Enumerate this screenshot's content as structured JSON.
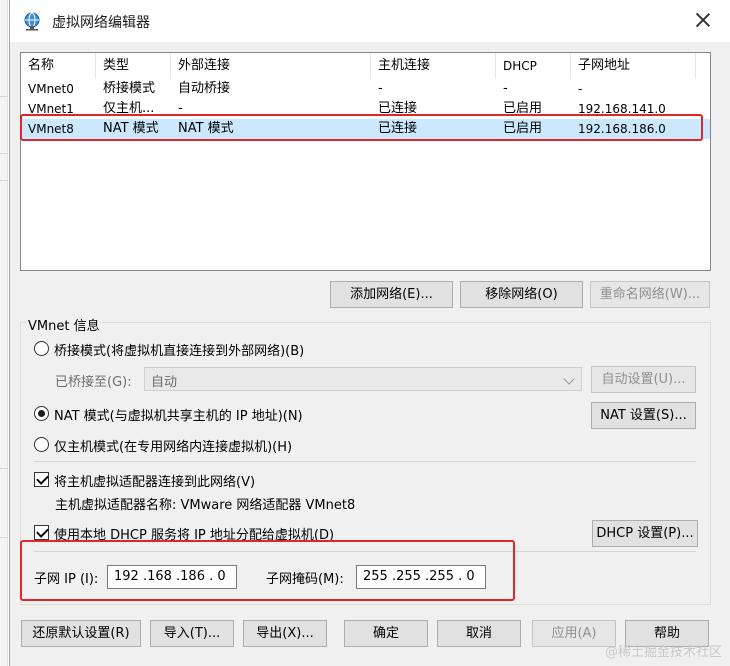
{
  "window": {
    "title": "虚拟网络编辑器",
    "icon": "network-globe-icon",
    "close_icon": "close-icon"
  },
  "table": {
    "columns": [
      "名称",
      "类型",
      "外部连接",
      "主机连接",
      "DHCP",
      "子网地址"
    ],
    "rows": [
      {
        "name": "VMnet0",
        "type": "桥接模式",
        "external": "自动桥接",
        "host": "-",
        "dhcp": "-",
        "subnet": "-"
      },
      {
        "name": "VMnet1",
        "type": "仅主机...",
        "external": "-",
        "host": "已连接",
        "dhcp": "已启用",
        "subnet": "192.168.141.0"
      },
      {
        "name": "VMnet8",
        "type": "NAT 模式",
        "external": "NAT 模式",
        "host": "已连接",
        "dhcp": "已启用",
        "subnet": "192.168.186.0"
      }
    ],
    "selected_row": "VMnet8"
  },
  "list_buttons": {
    "add": "添加网络(E)...",
    "remove": "移除网络(O)",
    "rename": "重命名网络(W)..."
  },
  "vmnet_info": {
    "group_label": "VMnet 信息",
    "bridged_label": "桥接模式(将虚拟机直接连接到外部网络)(B)",
    "bridged_to_label": "已桥接至(G):",
    "bridged_to_value": "自动",
    "auto_settings": "自动设置(U)...",
    "nat_label": "NAT 模式(与虚拟机共享主机的 IP 地址)(N)",
    "nat_settings": "NAT 设置(S)...",
    "hostonly_label": "仅主机模式(在专用网络内连接虚拟机)(H)",
    "connect_adapter_label": "将主机虚拟适配器连接到此网络(V)",
    "adapter_name_label": "主机虚拟适配器名称: VMware 网络适配器 VMnet8",
    "dhcp_label": "使用本地 DHCP 服务将 IP 地址分配给虚拟机(D)",
    "dhcp_settings": "DHCP 设置(P)...",
    "subnet_ip_label": "子网 IP (I):",
    "subnet_ip_value": "192 .168 .186 . 0",
    "subnet_mask_label": "子网掩码(M):",
    "subnet_mask_value": "255 .255 .255 . 0",
    "mode_selected": "nat",
    "connect_adapter_checked": true,
    "dhcp_checked": true
  },
  "footer": {
    "restore": "还原默认设置(R)",
    "import": "导入(T)...",
    "export": "导出(X)...",
    "ok": "确定",
    "cancel": "取消",
    "apply": "应用(A)",
    "help": "帮助"
  },
  "watermark": "@稀土掘金技术社区",
  "colors": {
    "highlight_border": "#e0262a",
    "selection": "#cce8ff",
    "window_bg": "#f0f0f0"
  }
}
